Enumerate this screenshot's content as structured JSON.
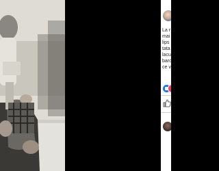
{
  "post": {
    "text_lines": [
      "La r",
      "mai",
      "lips",
      "tata",
      "lacu",
      "baro",
      "ce v"
    ]
  },
  "colors": {
    "panel_bg": "#ffffff",
    "like_blue": "#1877f2",
    "love_red": "#f33e58",
    "divider": "#ced0d4",
    "text": "#1c1e21"
  },
  "icons": {
    "author_avatar": "author-avatar",
    "reaction_like": "thumbs-up-icon",
    "reaction_love": "heart-icon",
    "like_button": "thumbs-up-outline-icon",
    "commenter_avatar": "commenter-avatar"
  }
}
